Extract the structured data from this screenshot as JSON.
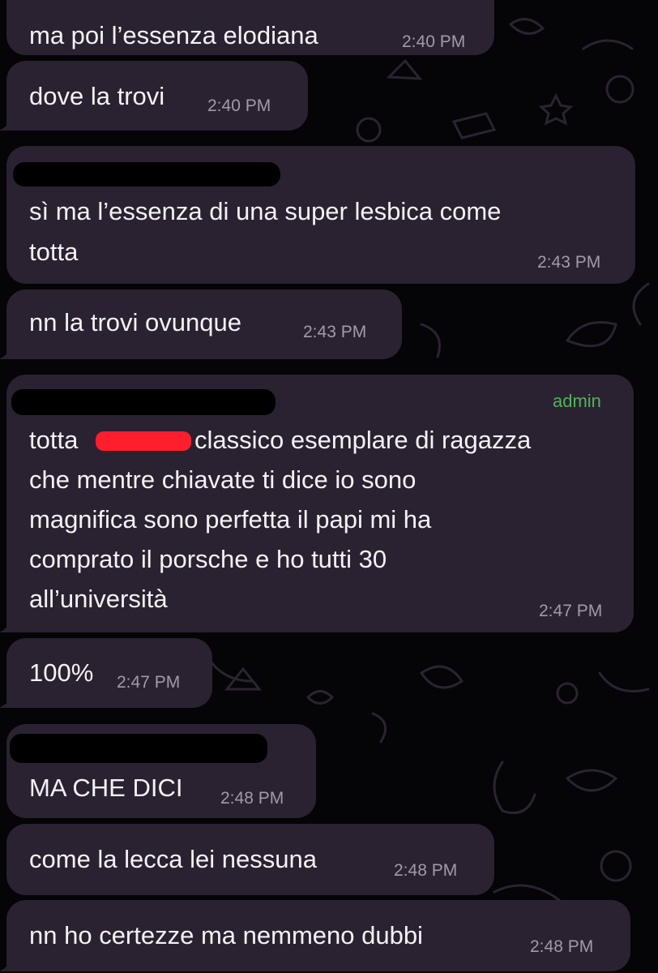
{
  "messages": [
    {
      "text": "ma poi l’essenza elodiana",
      "time": "2:40 PM"
    },
    {
      "text": "dove la trovi",
      "time": "2:40 PM"
    },
    {
      "lines": [
        "sì ma l’essenza di una super lesbica come",
        "totta"
      ],
      "time": "2:43 PM"
    },
    {
      "text": "nn la trovi ovunque",
      "time": "2:43 PM"
    },
    {
      "badge": "admin",
      "lines": [
        "totta",
        "classico esemplare di ragazza",
        "che mentre chiavate ti dice io sono",
        "magnifica sono perfetta il papi mi ha",
        "comprato il porsche e ho tutti 30",
        "all’università"
      ],
      "time": "2:47 PM"
    },
    {
      "text": "100%",
      "time": "2:47 PM"
    },
    {
      "text": "MA CHE DICI",
      "time": "2:48 PM"
    },
    {
      "text": "come la lecca lei nessuna",
      "time": "2:48 PM"
    },
    {
      "text": "nn ho certezze ma nemmeno dubbi",
      "time": "2:48 PM"
    }
  ],
  "colors": {
    "bubble": "#2a2230",
    "background": "#050406",
    "admin": "#4fb45a",
    "redaction": "#ff1e2b"
  }
}
